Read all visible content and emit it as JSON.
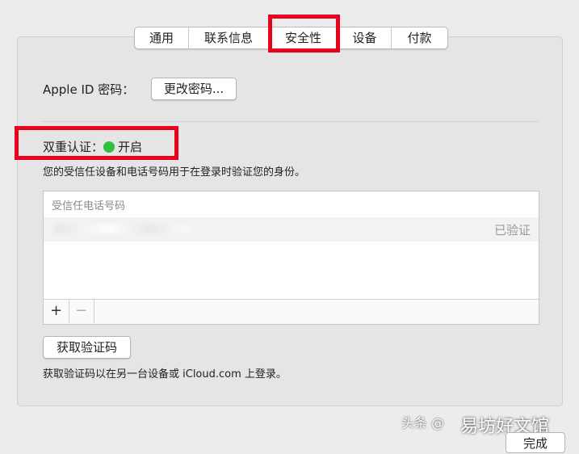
{
  "tabs": [
    {
      "label": "通用"
    },
    {
      "label": "联系信息"
    },
    {
      "label": "安全性"
    },
    {
      "label": "设备"
    },
    {
      "label": "付款"
    }
  ],
  "selected_tab": "安全性",
  "password": {
    "label": "Apple ID 密码：",
    "button": "更改密码..."
  },
  "two_factor": {
    "label": "双重认证：",
    "status": "开启",
    "status_color": "#2ec13f",
    "description": "您的受信任设备和电话号码用于在登录时验证您的身份。"
  },
  "phones": {
    "header": "受信任电话号码",
    "rows": [
      {
        "status": "已验证"
      }
    ],
    "add": "+",
    "remove": "−"
  },
  "code": {
    "button": "获取验证码",
    "description": "获取验证码以在另一台设备或 iCloud.com 上登录。"
  },
  "watermark": {
    "prefix": "头条 @",
    "text": "易坊好文馆"
  },
  "done_button": "完成",
  "highlight_color": "#e8001c"
}
